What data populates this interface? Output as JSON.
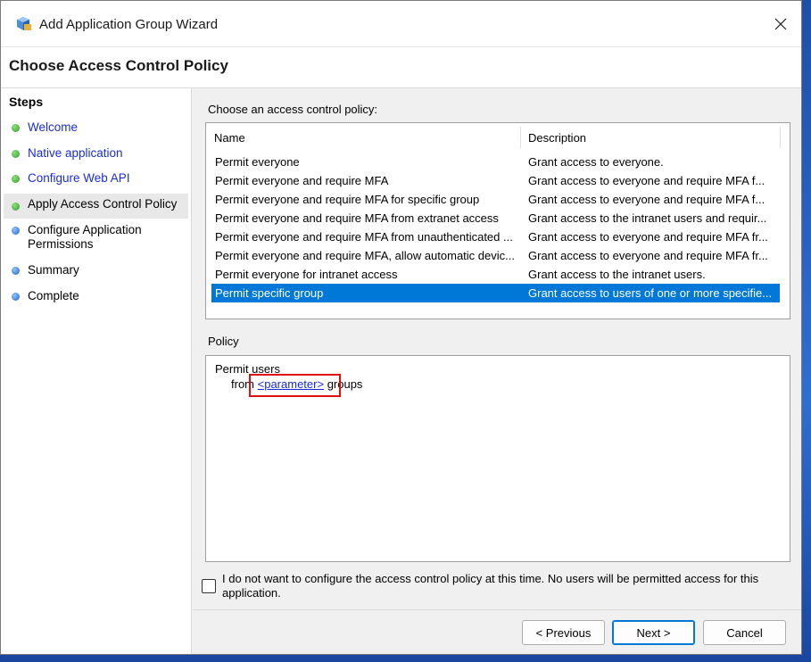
{
  "window": {
    "title": "Add Application Group Wizard"
  },
  "header": {
    "title": "Choose Access Control Policy"
  },
  "steps": {
    "heading": "Steps",
    "items": [
      {
        "label": "Welcome",
        "status": "complete"
      },
      {
        "label": "Native application",
        "status": "complete"
      },
      {
        "label": "Configure Web API",
        "status": "complete"
      },
      {
        "label": "Apply Access Control Policy",
        "status": "current"
      },
      {
        "label": "Configure Application Permissions",
        "status": "pending"
      },
      {
        "label": "Summary",
        "status": "pending"
      },
      {
        "label": "Complete",
        "status": "pending"
      }
    ]
  },
  "main": {
    "choose_label": "Choose an access control policy:",
    "table": {
      "columns": [
        "Name",
        "Description"
      ],
      "rows": [
        {
          "name": "Permit everyone",
          "description": "Grant access to everyone."
        },
        {
          "name": "Permit everyone and require MFA",
          "description": "Grant access to everyone and require MFA f..."
        },
        {
          "name": "Permit everyone and require MFA for specific group",
          "description": "Grant access to everyone and require MFA f..."
        },
        {
          "name": "Permit everyone and require MFA from extranet access",
          "description": "Grant access to the intranet users and requir..."
        },
        {
          "name": "Permit everyone and require MFA from unauthenticated ...",
          "description": "Grant access to everyone and require MFA fr..."
        },
        {
          "name": "Permit everyone and require MFA, allow automatic devic...",
          "description": "Grant access to everyone and require MFA fr..."
        },
        {
          "name": "Permit everyone for intranet access",
          "description": "Grant access to the intranet users."
        },
        {
          "name": "Permit specific group",
          "description": "Grant access to users of one or more specifie...",
          "selected": true
        }
      ]
    },
    "policy_label": "Policy",
    "policy": {
      "line1": "Permit users",
      "from": "from",
      "parameter": "<parameter>",
      "groups": "groups"
    },
    "checkbox_label": "I do not want to configure the access control policy at this time.  No users will be permitted access for this application.",
    "checkbox_checked": false
  },
  "buttons": {
    "previous": "< Previous",
    "next": "Next >",
    "cancel": "Cancel"
  },
  "colors": {
    "selection": "#0078d7",
    "link": "#1a2cd6",
    "highlight": "#e01010"
  }
}
